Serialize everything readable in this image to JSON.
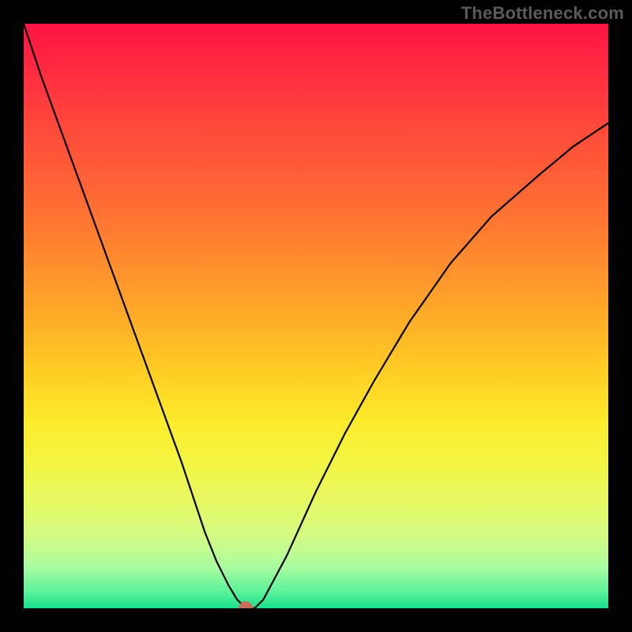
{
  "watermark": {
    "text": "TheBottleneck.com"
  },
  "chart_data": {
    "type": "line",
    "title": "",
    "xlabel": "",
    "ylabel": "",
    "xlim": [
      0,
      100
    ],
    "ylim": [
      0,
      100
    ],
    "legend": false,
    "grid": false,
    "background": "rainbow-vertical-gradient (red 0% → green 100%)",
    "series": [
      {
        "name": "bottleneck-curve",
        "x": [
          0,
          3,
          7,
          11,
          15,
          19,
          23,
          27,
          29,
          31,
          33,
          35,
          36.5,
          38,
          39.5,
          41,
          45,
          50,
          55,
          60,
          66,
          73,
          80,
          88,
          94,
          100
        ],
        "values": [
          100,
          91,
          80,
          69,
          58,
          47,
          36,
          25,
          19,
          13,
          8,
          4,
          1.5,
          0,
          0,
          1.5,
          9,
          20,
          30,
          39,
          49,
          59,
          67,
          74,
          79,
          83
        ]
      }
    ],
    "annotations": [
      {
        "name": "min-dot",
        "x": 38,
        "y": 0,
        "color": "#c96a5d"
      }
    ]
  }
}
